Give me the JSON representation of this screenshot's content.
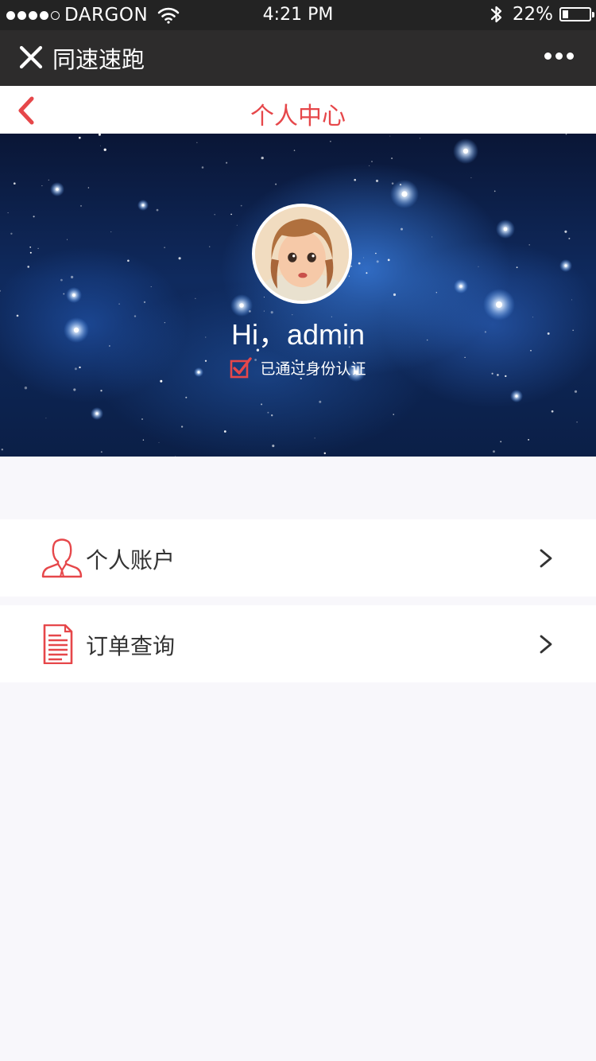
{
  "status_bar": {
    "carrier": "DARGON",
    "time": "4:21 PM",
    "battery_percent": "22%",
    "battery_level": 0.22
  },
  "app_bar": {
    "title": "同速速跑",
    "close_icon": "close-icon",
    "more_icon": "more-icon"
  },
  "nav": {
    "title": "个人中心",
    "back_icon": "chevron-left-icon"
  },
  "profile": {
    "greeting": "Hi，admin",
    "verified_text": "已通过身份认证",
    "verified_icon": "checkbox-checked-icon"
  },
  "menu": {
    "items": [
      {
        "label": "个人账户",
        "icon": "user-icon"
      },
      {
        "label": "订单查询",
        "icon": "document-icon"
      }
    ]
  },
  "colors": {
    "accent": "#e6474a",
    "status_bar_bg": "#232323",
    "app_bar_bg": "#2d2c2c",
    "page_bg": "#f8f7fb"
  }
}
